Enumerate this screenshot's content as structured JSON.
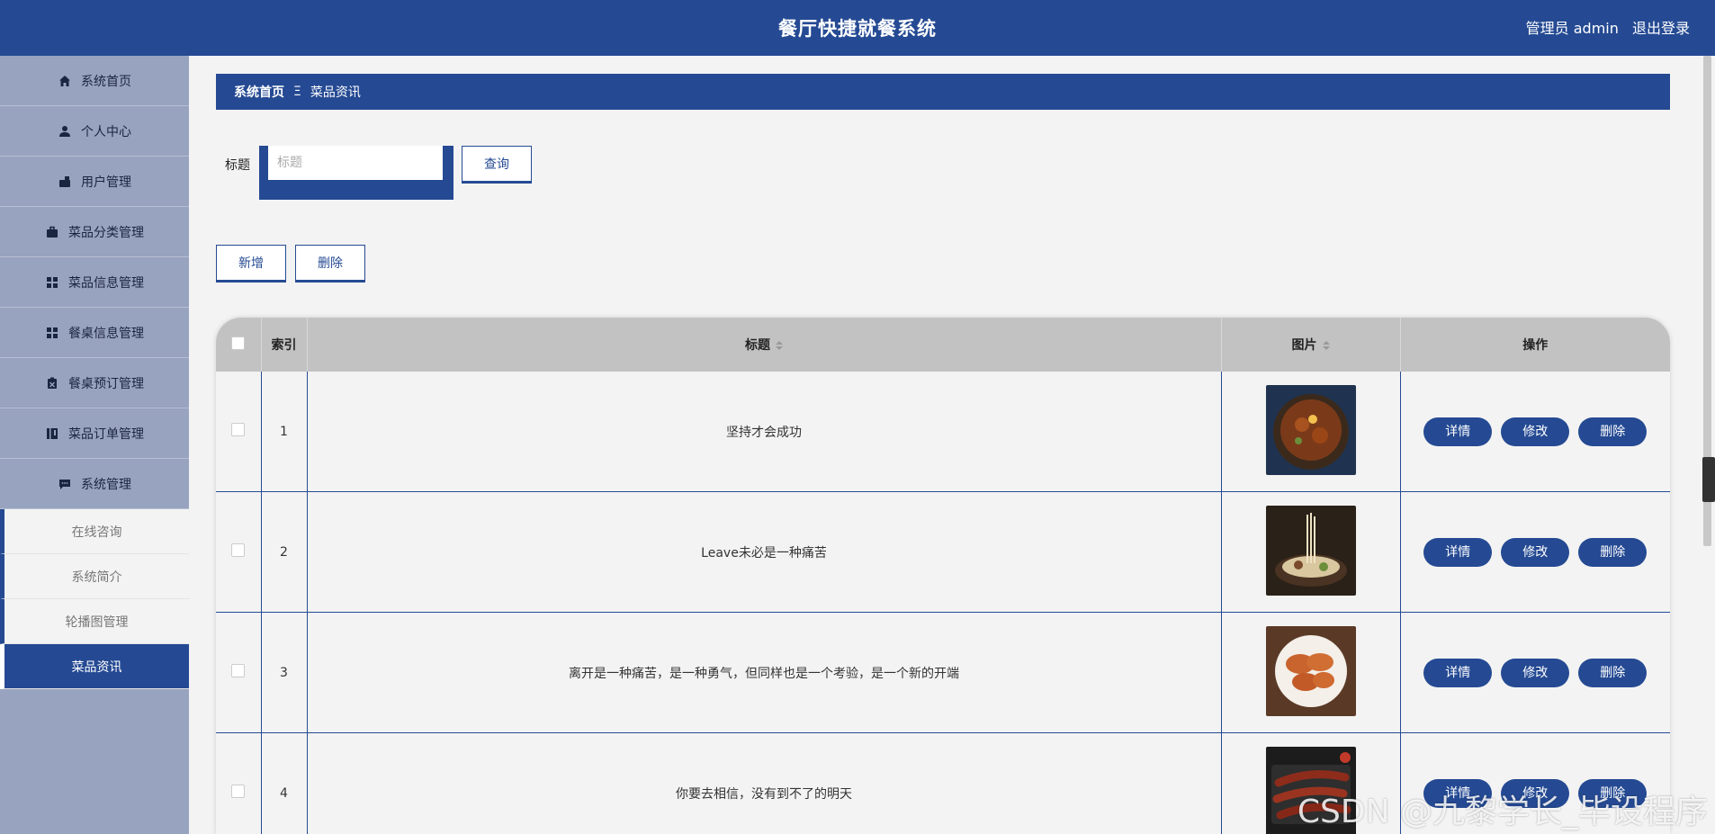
{
  "app": {
    "title": "餐厅快捷就餐系统",
    "user_label": "管理员 admin",
    "logout_label": "退出登录"
  },
  "sidebar": {
    "items": [
      {
        "label": "系统首页",
        "icon": "home-icon"
      },
      {
        "label": "个人中心",
        "icon": "user-icon"
      },
      {
        "label": "用户管理",
        "icon": "users-manage-icon"
      },
      {
        "label": "菜品分类管理",
        "icon": "briefcase-icon"
      },
      {
        "label": "菜品信息管理",
        "icon": "grid-icon"
      },
      {
        "label": "餐桌信息管理",
        "icon": "grid-icon"
      },
      {
        "label": "餐桌预订管理",
        "icon": "clipboard-icon"
      },
      {
        "label": "菜品订单管理",
        "icon": "book-icon"
      },
      {
        "label": "系统管理",
        "icon": "chat-icon"
      }
    ],
    "submenu": [
      {
        "label": "在线咨询"
      },
      {
        "label": "系统简介"
      },
      {
        "label": "轮播图管理"
      },
      {
        "label": "菜品资讯",
        "active": true
      }
    ]
  },
  "breadcrumb": {
    "home": "系统首页",
    "separator": "Ξ",
    "current": "菜品资讯"
  },
  "search": {
    "label": "标题",
    "placeholder": "标题",
    "value": "",
    "button": "查询"
  },
  "toolbar": {
    "add_label": "新增",
    "delete_label": "删除"
  },
  "table": {
    "columns": [
      "索引",
      "标题",
      "图片",
      "操作"
    ],
    "rows": [
      {
        "index": "1",
        "title": "坚持才会成功",
        "image": "clay-pot-stew"
      },
      {
        "index": "2",
        "title": "Leave未必是一种痛苦",
        "image": "noodle-bowl"
      },
      {
        "index": "3",
        "title": "离开是一种痛苦，是一种勇气，但同样也是一个考验，是一个新的开端",
        "image": "roast-chicken-legs"
      },
      {
        "index": "4",
        "title": "你要去相信，没有到不了的明天",
        "image": "grilled-sausages"
      }
    ],
    "actions": [
      "详情",
      "修改",
      "删除"
    ]
  },
  "watermark": "CSDN @九黎学长_毕设程序",
  "colors": {
    "primary": "#254a93",
    "sidebar_bg": "#98a3bf",
    "page_bg": "#f3f3f3",
    "table_header": "#c2c2c2"
  }
}
